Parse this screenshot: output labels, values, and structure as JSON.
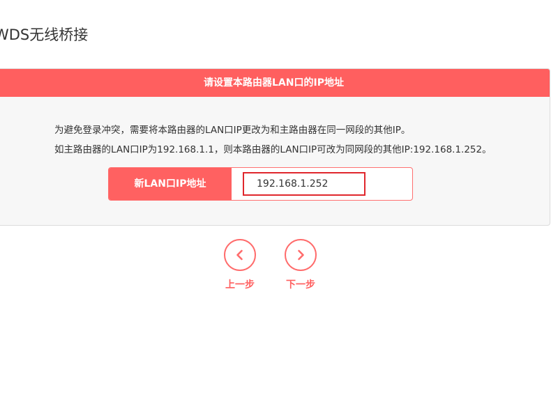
{
  "page": {
    "title": "WDS无线桥接"
  },
  "panel": {
    "header": "请设置本路由器LAN口的IP地址",
    "description_line1": "为避免登录冲突，需要将本路由器的LAN口IP更改为和主路由器在同一网段的其他IP。",
    "description_line2": "如主路由器的LAN口IP为192.168.1.1，则本路由器的LAN口IP可改为同网段的其他IP:192.168.1.252。",
    "lan_ip_field": {
      "label": "新LAN口IP地址",
      "value": "192.168.1.252"
    }
  },
  "navigation": {
    "prev_label": "上一步",
    "next_label": "下一步",
    "prev_icon": "chevron-left-icon",
    "next_icon": "chevron-right-icon"
  },
  "colors": {
    "accent": "#ff5f5f",
    "input_border": "#e0262c"
  }
}
